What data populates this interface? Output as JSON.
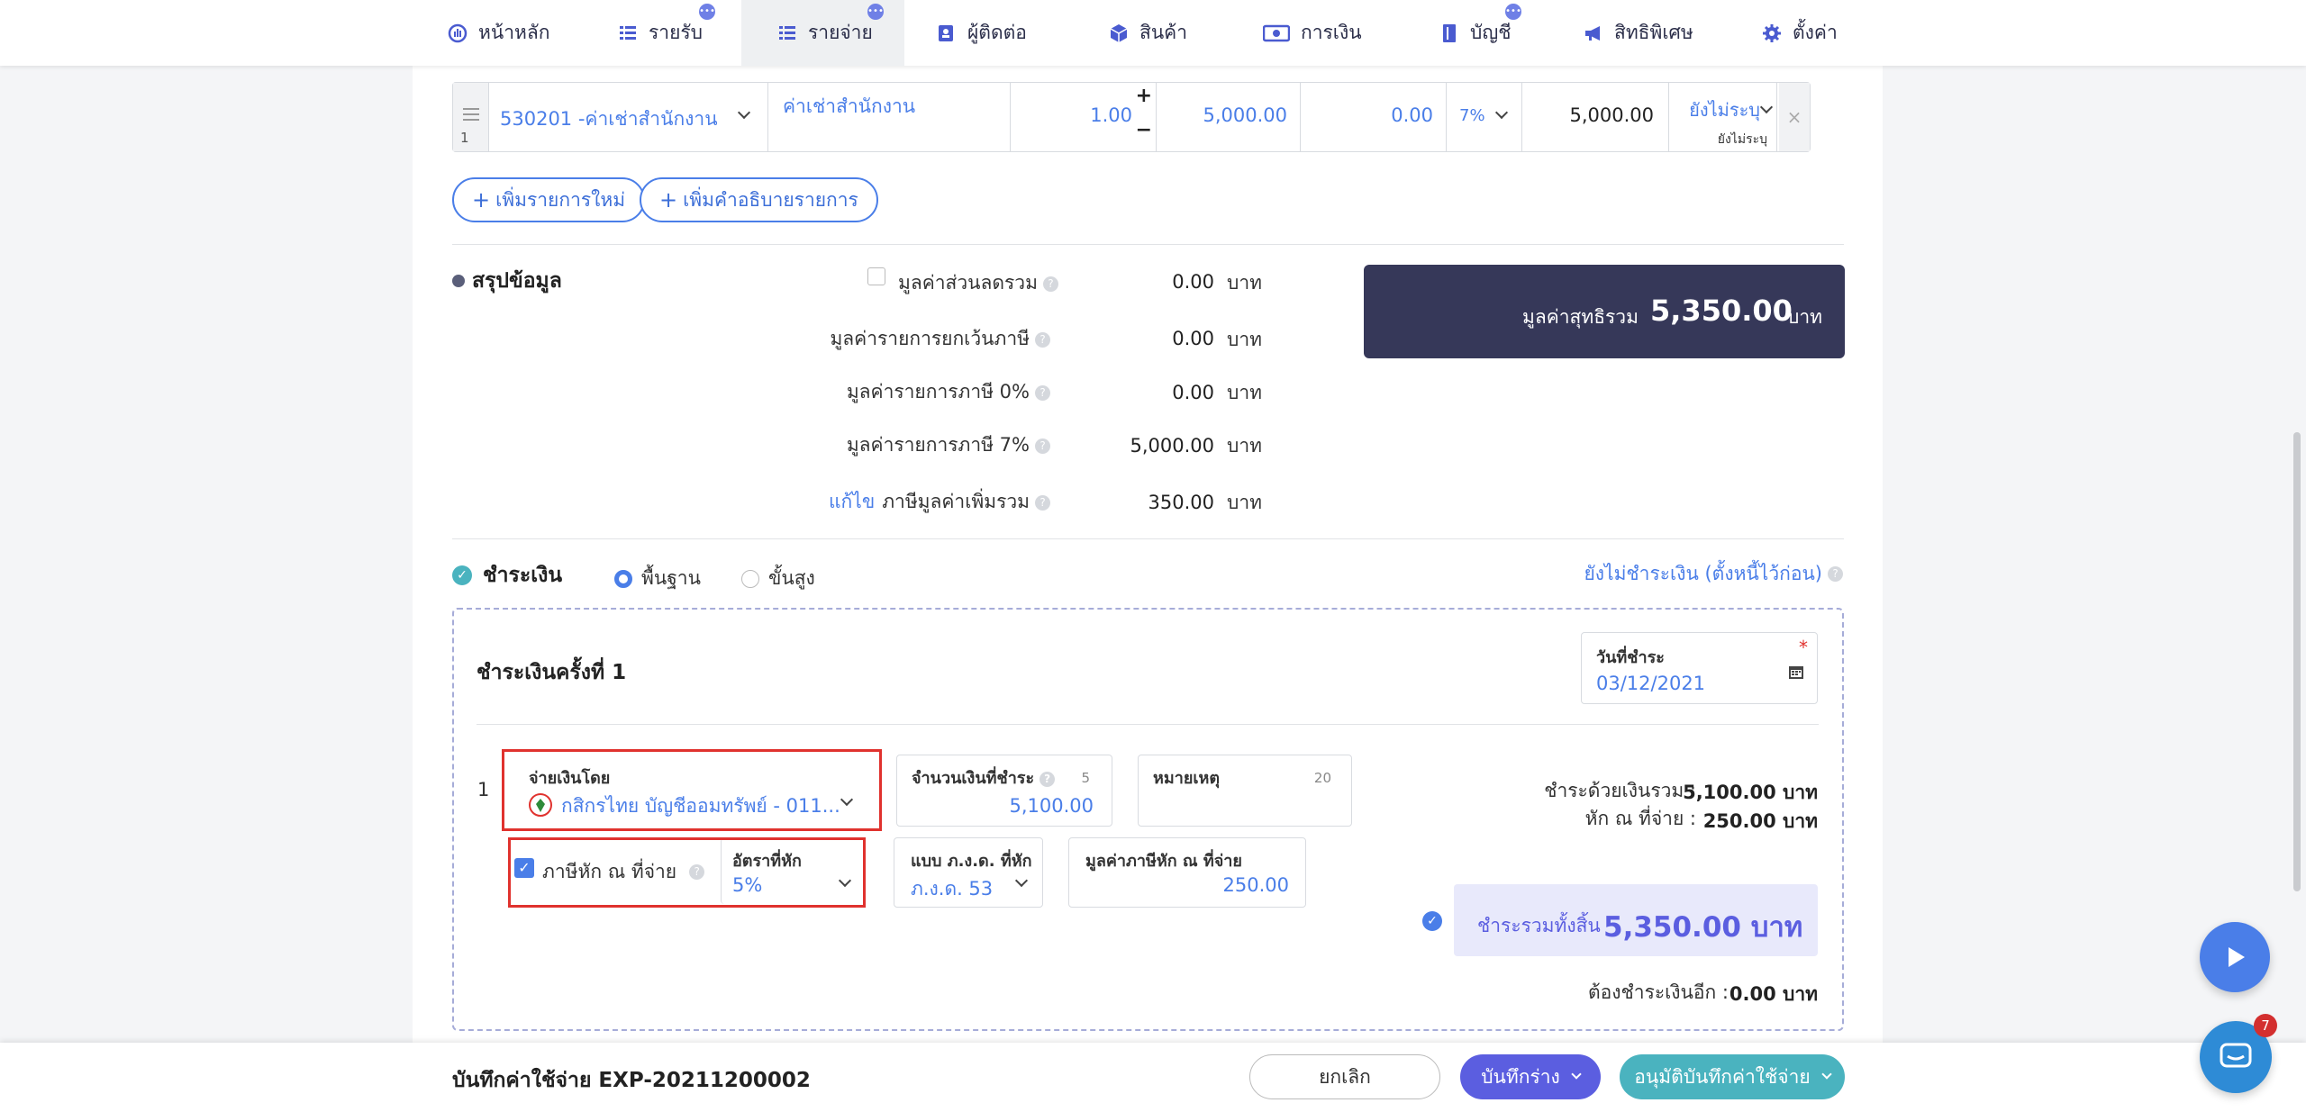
{
  "nav": {
    "items": [
      {
        "label": "หน้าหลัก",
        "icon": "dashboard-icon"
      },
      {
        "label": "รายรับ",
        "icon": "income-list-icon"
      },
      {
        "label": "รายจ่าย",
        "icon": "expense-list-icon"
      },
      {
        "label": "ผู้ติดต่อ",
        "icon": "contacts-icon"
      },
      {
        "label": "สินค้า",
        "icon": "box-icon"
      },
      {
        "label": "การเงิน",
        "icon": "money-icon"
      },
      {
        "label": "บัญชี",
        "icon": "book-icon"
      },
      {
        "label": "สิทธิพิเศษ",
        "icon": "megaphone-icon"
      },
      {
        "label": "ตั้งค่า",
        "icon": "gear-icon"
      }
    ]
  },
  "line_item": {
    "index": "1",
    "account": "530201 -ค่าเช่าสำนักงาน",
    "description": "ค่าเช่าสำนักงาน",
    "quantity": "1.00",
    "unit_price": "5,000.00",
    "discount": "0.00",
    "vat": "7%",
    "amount": "5,000.00",
    "wht_top": "ยังไม่ระบุ",
    "wht_bottom": "ยังไม่ระบุ"
  },
  "actions": {
    "add_item": "เพิ่มรายการใหม่",
    "add_description": "เพิ่มคำอธิบายรายการ"
  },
  "summary": {
    "title": "สรุปข้อมูล",
    "currency": "บาท",
    "rows": [
      {
        "label": "มูลค่าส่วนลดรวม",
        "value": "0.00"
      },
      {
        "label": "มูลค่ารายการยกเว้นภาษี",
        "value": "0.00"
      },
      {
        "label": "มูลค่ารายการภาษี 0%",
        "value": "0.00"
      },
      {
        "label": "มูลค่ารายการภาษี 7%",
        "value": "5,000.00"
      },
      {
        "label": "ภาษีมูลค่าเพิ่มรวม",
        "value": "350.00"
      }
    ],
    "edit_link": "แก้ไข",
    "net_label": "มูลค่าสุทธิรวม",
    "net_value": "5,350.00",
    "net_currency": "บาท"
  },
  "payment": {
    "title": "ชำระเงิน",
    "mode_basic": "พื้นฐาน",
    "mode_advanced": "ขั้นสูง",
    "unpaid_link": "ยังไม่ชำระเงิน (ตั้งหนี้ไว้ก่อน)",
    "round_title": "ชำระเงินครั้งที่ 1",
    "date_label": "วันที่ชำระ",
    "date_value": "03/12/2021",
    "row_index": "1",
    "paid_by_label": "จ่ายเงินโดย",
    "paid_by_value": "กสิกรไทย บัญชีออมทรัพย์ - 011...",
    "amount_label": "จำนวนเงินที่ชำระ",
    "amount_counter": "5",
    "amount_value": "5,100.00",
    "note_label": "หมายเหตุ",
    "note_counter": "20",
    "wht_label": "ภาษีหัก ณ ที่จ่าย",
    "wht_rate_label": "อัตราที่หัก",
    "wht_rate_value": "5%",
    "pnd_label": "แบบ ภ.ง.ด. ที่หัก",
    "pnd_value": "ภ.ง.ด. 53",
    "wht_amount_label": "มูลค่าภาษีหัก ณ ที่จ่าย",
    "wht_amount_value": "250.00",
    "paid_cash_label": "ชำระด้วยเงินรวม :",
    "paid_cash_value": "5,100.00 บาท",
    "wht_total_label": "หัก ณ ที่จ่าย :",
    "wht_total_value": "250.00 บาท",
    "grand_label": "ชำระรวมทั้งสิ้น",
    "grand_value": "5,350.00 บาท",
    "remaining_label": "ต้องชำระเงินอีก :",
    "remaining_value": "0.00 บาท"
  },
  "footer": {
    "doc_title": "บันทึกค่าใช้จ่าย EXP-20211200002",
    "cancel": "ยกเลิก",
    "save_draft": "บันทึกร่าง",
    "approve": "อนุมัติบันทึกค่าใช้จ่าย"
  },
  "chat_badge": "7",
  "colors": {
    "accent": "#4a7ee8",
    "navy": "#363859",
    "highlight_red": "#e0322e",
    "draft_purple": "#5b5ee0",
    "approve_teal": "#4ab3bf"
  }
}
